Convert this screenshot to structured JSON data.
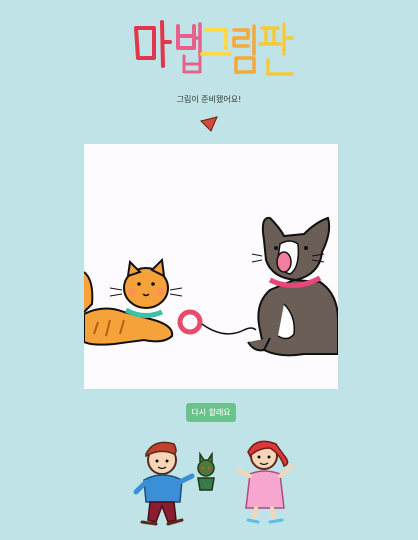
{
  "header": {
    "logo_text": "마법그림판",
    "subtitle": "그림이 준비됐어요!"
  },
  "actions": {
    "retry_label": "다시 할래요"
  },
  "colors": {
    "background": "#bfe3e6",
    "button": "#6cc28c",
    "arrow": "#d14a3a"
  }
}
